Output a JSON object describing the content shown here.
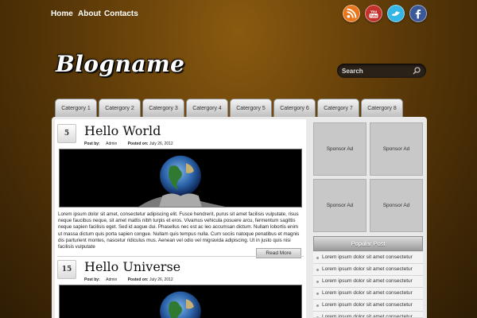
{
  "nav": {
    "items": [
      "Home",
      "About",
      "Contacts"
    ]
  },
  "social": [
    {
      "name": "rss-icon",
      "color": "#e8761c"
    },
    {
      "name": "youtube-icon",
      "color": "#c4302b",
      "label": "You Tube"
    },
    {
      "name": "twitter-icon",
      "color": "#33b5e5"
    },
    {
      "name": "facebook-icon",
      "color": "#3b5998"
    }
  ],
  "logo": "Blogname",
  "search": {
    "placeholder": "Search"
  },
  "categories": [
    "Catergory 1",
    "Catergory 2",
    "Catergory 3",
    "Catergory 4",
    "Catergory 5",
    "Catergory 6",
    "Catergory 7",
    "Catergory 8"
  ],
  "posts": [
    {
      "day": "5",
      "title": "Hello World",
      "post_by_label": "Post by:",
      "author": "Admin",
      "posted_on_label": "Posted on:",
      "date": "July 26, 2012",
      "excerpt": "Lorem ipsum dolor sit amet, consectetur adipiscing elit. Fusce hendrerit, purus sit amet facilisis vulputate, risus neque faucibus neque, sit amet mattis nibh turpis et eros. Vivamus vehicula posuere arcu, fermentum sagittis neque sapien facilisis eget. Sed id augue dui. Phasellus nec est ac leo accumsan dictum. Nullam lobortis enim ut massa dictum quis porta sapien congue. Nullam quis tempus nulla. Cum sociis natoque penatibus et magnis dis parturient montes, nascetur ridiculus mus. Aenean vel odio vel migravida adipiscing. Ut in justo quis nisi facilisis vulputate",
      "read_more": "Read More"
    },
    {
      "day": "15",
      "title": "Hello Universe",
      "post_by_label": "Post by:",
      "author": "Admin",
      "posted_on_label": "Posted on:",
      "date": "July 26, 2012"
    }
  ],
  "sidebar": {
    "ads": [
      "Sponsor Ad",
      "Sponsor Ad",
      "Sponsor Ad",
      "Sponsor Ad"
    ],
    "popular_title": "Popular Post",
    "popular_items": [
      "Lorem ipsum dolor sit amet consectetur",
      "Lorem ipsum dolor sit amet consectetur",
      "Lorem ipsum dolor sit amet consectetur",
      "Lorem ipsum dolor sit amet consectetur",
      "Lorem ipsum dolor sit amet consectetur",
      "Lorem ipsum dolor sit amet consectetur"
    ]
  }
}
